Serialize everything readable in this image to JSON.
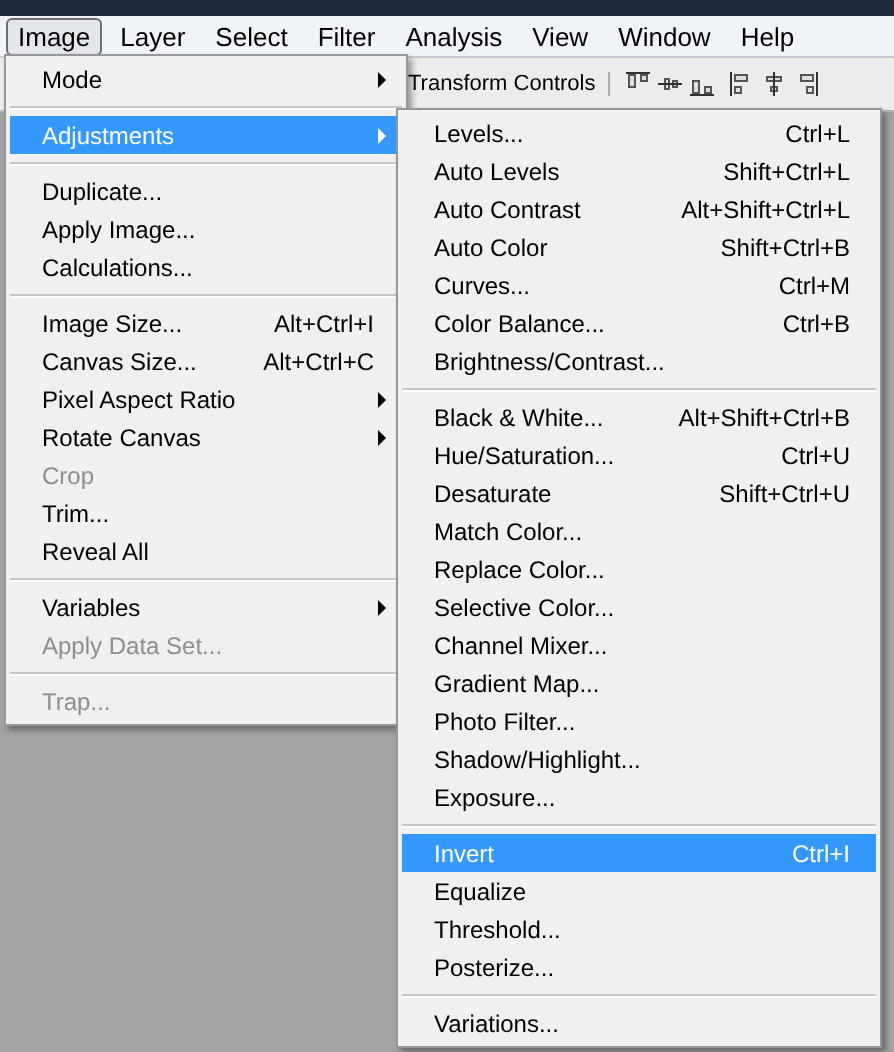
{
  "menubar": [
    {
      "label": "Image",
      "selected": true
    },
    {
      "label": "Layer",
      "selected": false
    },
    {
      "label": "Select",
      "selected": false
    },
    {
      "label": "Filter",
      "selected": false
    },
    {
      "label": "Analysis",
      "selected": false
    },
    {
      "label": "View",
      "selected": false
    },
    {
      "label": "Window",
      "selected": false
    },
    {
      "label": "Help",
      "selected": false
    }
  ],
  "options_bar": {
    "label": "Transform Controls"
  },
  "image_menu": [
    [
      {
        "label": "Mode",
        "submenu": true,
        "disabled": false,
        "selected": false
      }
    ],
    [
      {
        "label": "Adjustments",
        "submenu": true,
        "disabled": false,
        "selected": true
      }
    ],
    [
      {
        "label": "Duplicate...",
        "submenu": false,
        "disabled": false,
        "selected": false
      },
      {
        "label": "Apply Image...",
        "submenu": false,
        "disabled": false,
        "selected": false
      },
      {
        "label": "Calculations...",
        "submenu": false,
        "disabled": false,
        "selected": false
      }
    ],
    [
      {
        "label": "Image Size...",
        "shortcut": "Alt+Ctrl+I",
        "submenu": false,
        "disabled": false,
        "selected": false
      },
      {
        "label": "Canvas Size...",
        "shortcut": "Alt+Ctrl+C",
        "submenu": false,
        "disabled": false,
        "selected": false
      },
      {
        "label": "Pixel Aspect Ratio",
        "submenu": true,
        "disabled": false,
        "selected": false
      },
      {
        "label": "Rotate Canvas",
        "submenu": true,
        "disabled": false,
        "selected": false
      },
      {
        "label": "Crop",
        "submenu": false,
        "disabled": true,
        "selected": false
      },
      {
        "label": "Trim...",
        "submenu": false,
        "disabled": false,
        "selected": false
      },
      {
        "label": "Reveal All",
        "submenu": false,
        "disabled": false,
        "selected": false
      }
    ],
    [
      {
        "label": "Variables",
        "submenu": true,
        "disabled": false,
        "selected": false
      },
      {
        "label": "Apply Data Set...",
        "submenu": false,
        "disabled": true,
        "selected": false
      }
    ],
    [
      {
        "label": "Trap...",
        "submenu": false,
        "disabled": true,
        "selected": false
      }
    ]
  ],
  "adjustments_menu": [
    [
      {
        "label": "Levels...",
        "shortcut": "Ctrl+L",
        "disabled": false,
        "selected": false
      },
      {
        "label": "Auto Levels",
        "shortcut": "Shift+Ctrl+L",
        "disabled": false,
        "selected": false
      },
      {
        "label": "Auto Contrast",
        "shortcut": "Alt+Shift+Ctrl+L",
        "disabled": false,
        "selected": false
      },
      {
        "label": "Auto Color",
        "shortcut": "Shift+Ctrl+B",
        "disabled": false,
        "selected": false
      },
      {
        "label": "Curves...",
        "shortcut": "Ctrl+M",
        "disabled": false,
        "selected": false
      },
      {
        "label": "Color Balance...",
        "shortcut": "Ctrl+B",
        "disabled": false,
        "selected": false
      },
      {
        "label": "Brightness/Contrast...",
        "disabled": false,
        "selected": false
      }
    ],
    [
      {
        "label": "Black & White...",
        "shortcut": "Alt+Shift+Ctrl+B",
        "disabled": false,
        "selected": false
      },
      {
        "label": "Hue/Saturation...",
        "shortcut": "Ctrl+U",
        "disabled": false,
        "selected": false
      },
      {
        "label": "Desaturate",
        "shortcut": "Shift+Ctrl+U",
        "disabled": false,
        "selected": false
      },
      {
        "label": "Match Color...",
        "disabled": false,
        "selected": false
      },
      {
        "label": "Replace Color...",
        "disabled": false,
        "selected": false
      },
      {
        "label": "Selective Color...",
        "disabled": false,
        "selected": false
      },
      {
        "label": "Channel Mixer...",
        "disabled": false,
        "selected": false
      },
      {
        "label": "Gradient Map...",
        "disabled": false,
        "selected": false
      },
      {
        "label": "Photo Filter...",
        "disabled": false,
        "selected": false
      },
      {
        "label": "Shadow/Highlight...",
        "disabled": false,
        "selected": false
      },
      {
        "label": "Exposure...",
        "disabled": false,
        "selected": false
      }
    ],
    [
      {
        "label": "Invert",
        "shortcut": "Ctrl+I",
        "disabled": false,
        "selected": true
      },
      {
        "label": "Equalize",
        "disabled": false,
        "selected": false
      },
      {
        "label": "Threshold...",
        "disabled": false,
        "selected": false
      },
      {
        "label": "Posterize...",
        "disabled": false,
        "selected": false
      }
    ],
    [
      {
        "label": "Variations...",
        "disabled": false,
        "selected": false
      }
    ]
  ]
}
